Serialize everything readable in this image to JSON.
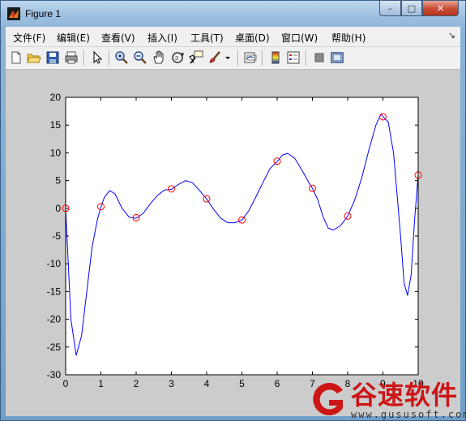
{
  "window": {
    "title": "Figure 1",
    "minimize": "–",
    "maximize": "□",
    "close": "✕"
  },
  "menu": [
    "文件(F)",
    "编辑(E)",
    "查看(V)",
    "插入(I)",
    "工具(T)",
    "桌面(D)",
    "窗口(W)",
    "帮助(H)"
  ],
  "menu_overflow": "↘",
  "toolbar": {
    "buttons": [
      "new-figure-icon",
      "open-file-icon",
      "save-icon",
      "print-icon",
      "edit-plot-arrow-icon",
      "zoom-in-icon",
      "zoom-out-icon",
      "pan-hand-icon",
      "rotate-3d-icon",
      "data-cursor-icon",
      "brush-icon",
      "brush-dropdown-icon",
      "link-plot-icon",
      "insert-colorbar-icon",
      "insert-legend-icon",
      "hide-plot-tools-icon",
      "show-plot-tools-icon"
    ]
  },
  "chart_data": {
    "type": "line",
    "xlim": [
      0,
      10
    ],
    "ylim": [
      -30,
      20
    ],
    "xticks": [
      0,
      1,
      2,
      3,
      4,
      5,
      6,
      7,
      8,
      9,
      10
    ],
    "yticks": [
      20,
      15,
      10,
      5,
      0,
      -5,
      -10,
      -15,
      -20,
      -25,
      -30
    ],
    "grid": false,
    "series": [
      {
        "style": "blue-line",
        "x": [
          0,
          0.15,
          0.3,
          0.45,
          0.6,
          0.75,
          0.9,
          1.0,
          1.1,
          1.25,
          1.4,
          1.6,
          1.8,
          2.0,
          2.2,
          2.4,
          2.6,
          2.8,
          3.0,
          3.2,
          3.4,
          3.6,
          3.8,
          4.0,
          4.2,
          4.4,
          4.6,
          4.8,
          5.0,
          5.2,
          5.4,
          5.6,
          5.8,
          6.0,
          6.15,
          6.3,
          6.5,
          6.7,
          6.9,
          7.0,
          7.15,
          7.3,
          7.45,
          7.6,
          7.8,
          8.0,
          8.2,
          8.4,
          8.6,
          8.8,
          8.95,
          9.0,
          9.15,
          9.3,
          9.5,
          9.6,
          9.7,
          9.8,
          9.9,
          10.0
        ],
        "y": [
          0,
          -20,
          -26.5,
          -23,
          -15,
          -7,
          -2,
          0.2,
          2,
          3.2,
          2.6,
          0,
          -1.6,
          -1.8,
          -0.9,
          0.8,
          2.3,
          3.3,
          3.4,
          4.3,
          5.0,
          4.6,
          3.2,
          1.7,
          -0.2,
          -1.8,
          -2.6,
          -2.6,
          -2.1,
          -0.4,
          2.1,
          4.7,
          7.2,
          8.4,
          9.6,
          9.9,
          9.0,
          6.9,
          4.6,
          3.6,
          1.6,
          -1.5,
          -3.6,
          -3.9,
          -3.1,
          -1.4,
          1.5,
          5.5,
          10.5,
          15.0,
          17.0,
          16.5,
          15.6,
          10,
          -5,
          -13.5,
          -15.7,
          -12,
          -2,
          6.0
        ]
      },
      {
        "style": "red-circle",
        "x": [
          0,
          1,
          2,
          3,
          4,
          5,
          6,
          7,
          8,
          9,
          10
        ],
        "y": [
          0,
          0.3,
          -1.7,
          3.5,
          1.7,
          -2.1,
          8.5,
          3.6,
          -1.4,
          16.5,
          6.0
        ]
      }
    ]
  },
  "watermark": {
    "brand": "谷速软件",
    "url": "www.gususoft.com"
  }
}
